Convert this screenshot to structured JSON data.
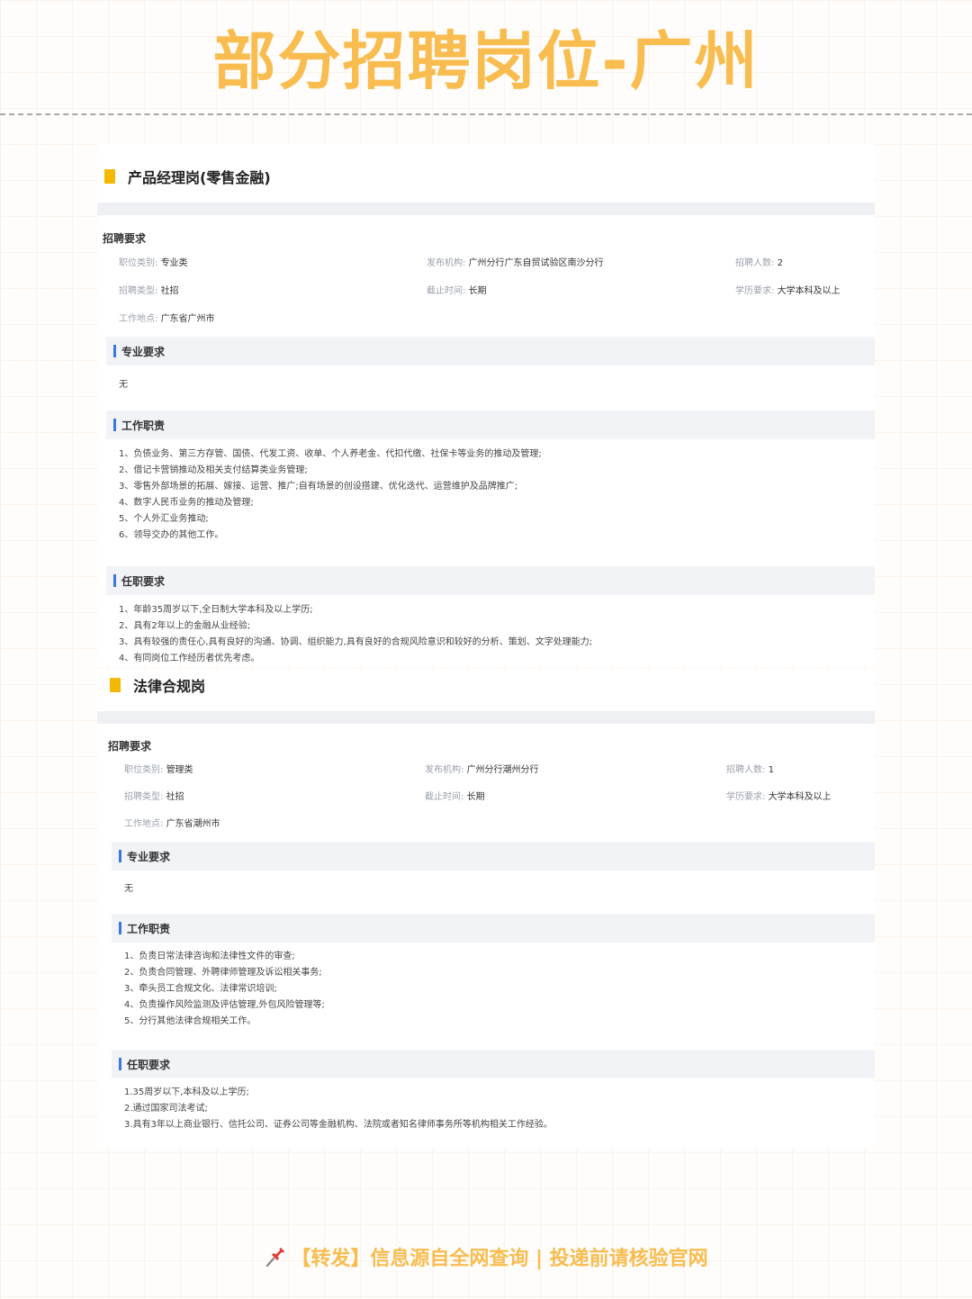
{
  "title": "部分招聘岗位-广州",
  "footer": {
    "text": "【转发】信息源自全网查询 | 投递前请核验官网",
    "icon": "pushpin-icon"
  },
  "colors": {
    "title": "#f9bc4f",
    "bookmark": "#f5b800",
    "section_bar": "#3a78e0"
  },
  "jobs": [
    {
      "title": "产品经理岗(零售金融)",
      "recruit_heading": "招聘要求",
      "info": {
        "category_label": "职位类别:",
        "category": "专业类",
        "org_label": "发布机构:",
        "org": "广州分行广东自贸试验区南沙分行",
        "count_label": "招聘人数:",
        "count": "2",
        "type_label": "招聘类型:",
        "type": "社招",
        "deadline_label": "截止时间:",
        "deadline": "长期",
        "edu_label": "学历要求:",
        "edu": "大学本科及以上",
        "location_label": "工作地点:",
        "location": "广东省广州市"
      },
      "major_heading": "专业要求",
      "major": "无",
      "duties_heading": "工作职责",
      "duties": [
        "1、负债业务、第三方存管、国债、代发工资、收单、个人养老金、代扣代缴、社保卡等业务的推动及管理;",
        "2、借记卡营销推动及相关支付结算类业务管理;",
        "3、零售外部场景的拓展、嫁接、运营、推广;自有场景的创设搭建、优化迭代、运营维护及品牌推广;",
        "4、数字人民币业务的推动及管理;",
        "5、个人外汇业务推动;",
        "6、领导交办的其他工作。"
      ],
      "qual_heading": "任职要求",
      "quals": [
        "1、年龄35周岁以下,全日制大学本科及以上学历;",
        "2、具有2年以上的金融从业经验;",
        "3、具有较强的责任心,具有良好的沟通、协调、组织能力,具有良好的合规风险意识和较好的分析、策划、文字处理能力;",
        "4、有同岗位工作经历者优先考虑。"
      ]
    },
    {
      "title": "法律合规岗",
      "recruit_heading": "招聘要求",
      "info": {
        "category_label": "职位类别:",
        "category": "管理类",
        "org_label": "发布机构:",
        "org": "广州分行潮州分行",
        "count_label": "招聘人数:",
        "count": "1",
        "type_label": "招聘类型:",
        "type": "社招",
        "deadline_label": "截止时间:",
        "deadline": "长期",
        "edu_label": "学历要求:",
        "edu": "大学本科及以上",
        "location_label": "工作地点:",
        "location": "广东省潮州市"
      },
      "major_heading": "专业要求",
      "major": "无",
      "duties_heading": "工作职责",
      "duties": [
        "1、负责日常法律咨询和法律性文件的审查;",
        "2、负责合同管理、外聘律师管理及诉讼相关事务;",
        "3、牵头员工合规文化、法律常识培训;",
        "4、负责操作风险监测及评估管理,外包风险管理等;",
        "5、分行其他法律合规相关工作。"
      ],
      "qual_heading": "任职要求",
      "quals": [
        "1.35周岁以下,本科及以上学历;",
        "2.通过国家司法考试;",
        "3.具有3年以上商业银行、信托公司、证券公司等金融机构、法院或者知名律师事务所等机构相关工作经验。"
      ]
    }
  ]
}
